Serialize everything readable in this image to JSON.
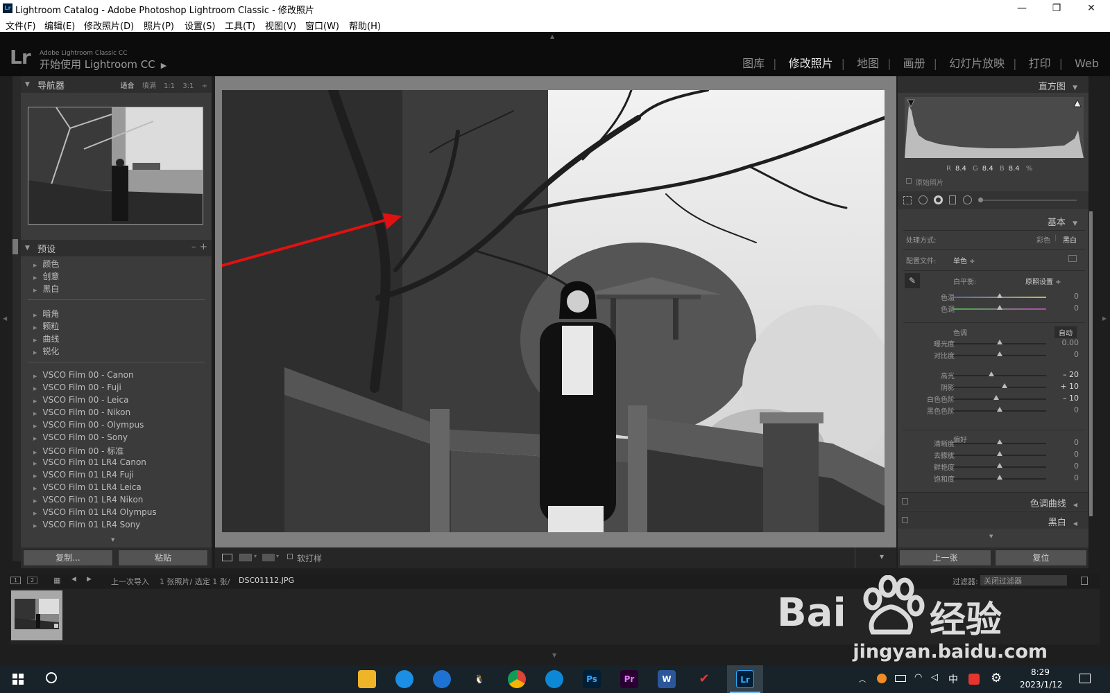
{
  "window": {
    "title": "Lightroom Catalog - Adobe Photoshop Lightroom Classic - 修改照片",
    "app_icon": "Lr",
    "controls": [
      "—",
      "❐",
      "✕"
    ]
  },
  "menu": [
    "文件(F)",
    "编辑(E)",
    "修改照片(D)",
    "照片(P)",
    "设置(S)",
    "工具(T)",
    "视图(V)",
    "窗口(W)",
    "帮助(H)"
  ],
  "identity": {
    "logo": "Lr",
    "line1": "Adobe Lightroom Classic CC",
    "line2": "开始使用 Lightroom CC",
    "play": "▶"
  },
  "modules": [
    {
      "label": "图库",
      "active": false
    },
    {
      "label": "修改照片",
      "active": true
    },
    {
      "label": "地图",
      "active": false
    },
    {
      "label": "画册",
      "active": false
    },
    {
      "label": "幻灯片放映",
      "active": false
    },
    {
      "label": "打印",
      "active": false
    },
    {
      "label": "Web",
      "active": false
    }
  ],
  "navigator": {
    "title": "导航器",
    "zoom_options": [
      "适合",
      "填满",
      "1:1",
      "3:1"
    ],
    "active_zoom": "适合",
    "more": "÷"
  },
  "presets": {
    "title": "预设",
    "actions": [
      "–",
      "+"
    ],
    "group1": [
      "颜色",
      "创意",
      "黑白"
    ],
    "group2": [
      "暗角",
      "颗粒",
      "曲线",
      "锐化"
    ],
    "group3": [
      "VSCO Film 00 - Canon",
      "VSCO Film 00 - Fuji",
      "VSCO Film 00 - Leica",
      "VSCO Film 00 - Nikon",
      "VSCO Film 00 - Olympus",
      "VSCO Film 00 - Sony",
      "VSCO Film 00 - 标准",
      "VSCO Film 01 LR4 Canon",
      "VSCO Film 01 LR4 Fuji",
      "VSCO Film 01 LR4 Leica",
      "VSCO Film 01 LR4 Nikon",
      "VSCO Film 01 LR4 Olympus",
      "VSCO Film 01 LR4 Sony"
    ]
  },
  "left_buttons": {
    "copy": "复制...",
    "paste": "粘贴"
  },
  "toolbar": {
    "softproof": "软打样",
    "dropdown": "▾"
  },
  "histogram": {
    "title": "直方图",
    "r_label": "R",
    "r": "8.4",
    "g_label": "G",
    "g": "8.4",
    "b_label": "B",
    "b": "8.4",
    "unit": "%",
    "original_photo": "原始照片"
  },
  "basic": {
    "title": "基本",
    "treatment_label": "处理方式:",
    "treatment_color": "彩色",
    "treatment_bw": "黑白",
    "profile_label": "配置文件:",
    "profile_value": "单色 ÷",
    "wb_label": "白平衡:",
    "wb_value": "原照设置 ÷",
    "tone_label": "色调",
    "auto": "自动",
    "presence_label": "偏好",
    "sliders": [
      {
        "label": "色温",
        "value": "0",
        "pos": 0.5
      },
      {
        "label": "色调",
        "value": "0",
        "pos": 0.5
      },
      {
        "label": "曝光度",
        "value": "0.00",
        "pos": 0.5
      },
      {
        "label": "对比度",
        "value": "0",
        "pos": 0.5
      },
      {
        "label": "高光",
        "value": "– 20",
        "pos": 0.41
      },
      {
        "label": "阴影",
        "value": "+ 10",
        "pos": 0.55
      },
      {
        "label": "白色色阶",
        "value": "– 10",
        "pos": 0.46
      },
      {
        "label": "黑色色阶",
        "value": "0",
        "pos": 0.5
      },
      {
        "label": "清晰度",
        "value": "0",
        "pos": 0.5
      },
      {
        "label": "去朦胧",
        "value": "0",
        "pos": 0.5
      },
      {
        "label": "鲜艳度",
        "value": "0",
        "pos": 0.5
      },
      {
        "label": "饱和度",
        "value": "0",
        "pos": 0.5
      }
    ]
  },
  "tone_curve": "色调曲线",
  "bw_panel": "黑白",
  "right_buttons": {
    "prev": "上一张",
    "reset": "复位"
  },
  "filmbar": {
    "source": "上一次导入",
    "info": "1 张照片/ 选定 1 张/",
    "filename": "DSC01112.JPG",
    "filter_label": "过滤器:",
    "filter_value": "关闭过滤器"
  },
  "taskbar": {
    "time": "8:29",
    "date": "2023/1/12",
    "ime": "中",
    "apps": [
      "Ps",
      "Pr",
      "W",
      "Lr"
    ]
  },
  "watermark": {
    "brand": "Bai",
    "brand2": "经验",
    "url": "jingyan.baidu.com"
  }
}
